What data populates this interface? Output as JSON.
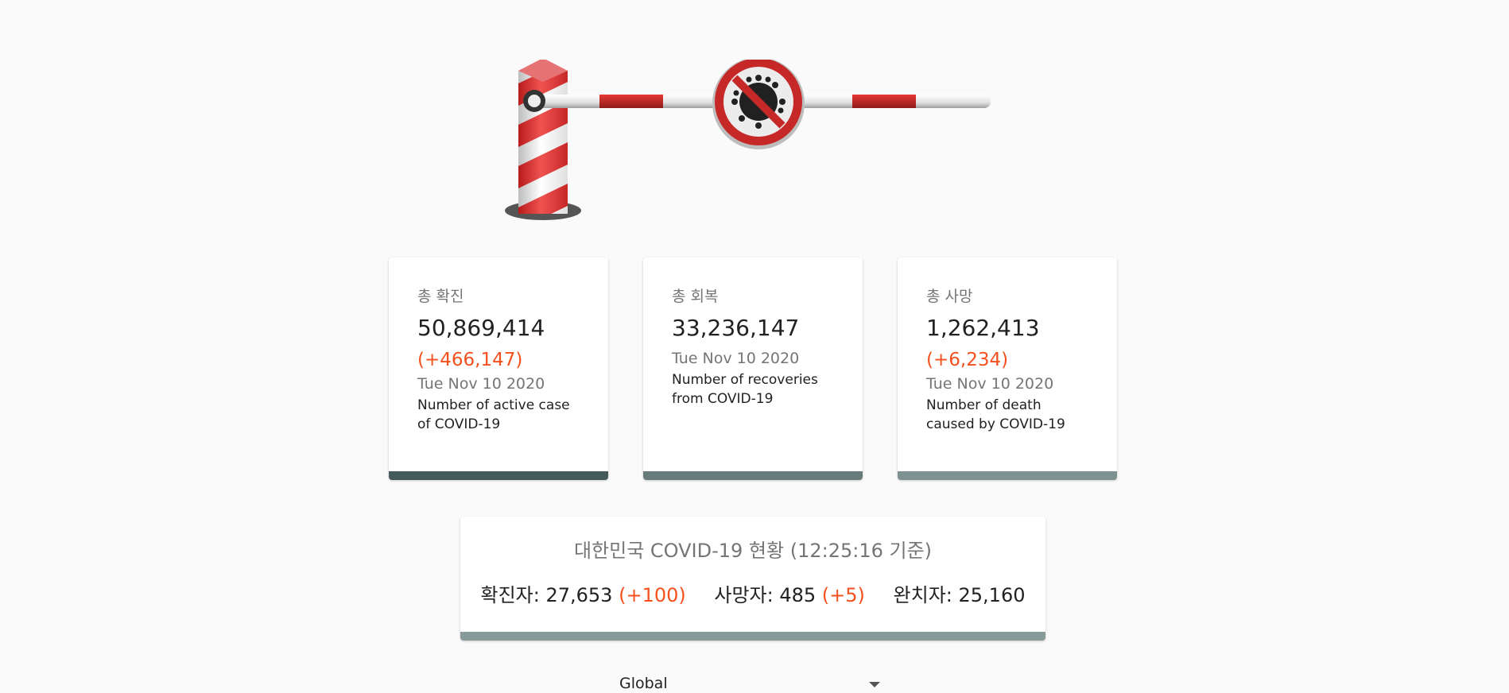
{
  "cards": [
    {
      "title": "총 확진",
      "value": "50,869,414",
      "delta": "(+466,147)",
      "date": "Tue Nov 10 2020",
      "description": "Number of active case of COVID-19",
      "bar_color": "#455a5a"
    },
    {
      "title": "총 회복",
      "value": "33,236,147",
      "delta": "",
      "date": "Tue Nov 10 2020",
      "description": "Number of recoveries from COVID-19",
      "bar_color": "#687b7b"
    },
    {
      "title": "총 사망",
      "value": "1,262,413",
      "delta": "(+6,234)",
      "date": "Tue Nov 10 2020",
      "description": "Number of death caused by COVID-19",
      "bar_color": "#7f9090"
    }
  ],
  "korea": {
    "title": "대한민국 COVID-19 현황 (12:25:16 기준)",
    "confirmed_label": "확진자: 27,653",
    "confirmed_delta": "(+100)",
    "deaths_label": "사망자: 485",
    "deaths_delta": "(+5)",
    "recovered_label": "완치자: 25,160"
  },
  "region_select": {
    "value": "Global"
  },
  "colors": {
    "accent_red": "#f4511e",
    "barrier_red": "#c62828"
  },
  "icons": {
    "hero": "border-barrier-no-virus-icon"
  }
}
